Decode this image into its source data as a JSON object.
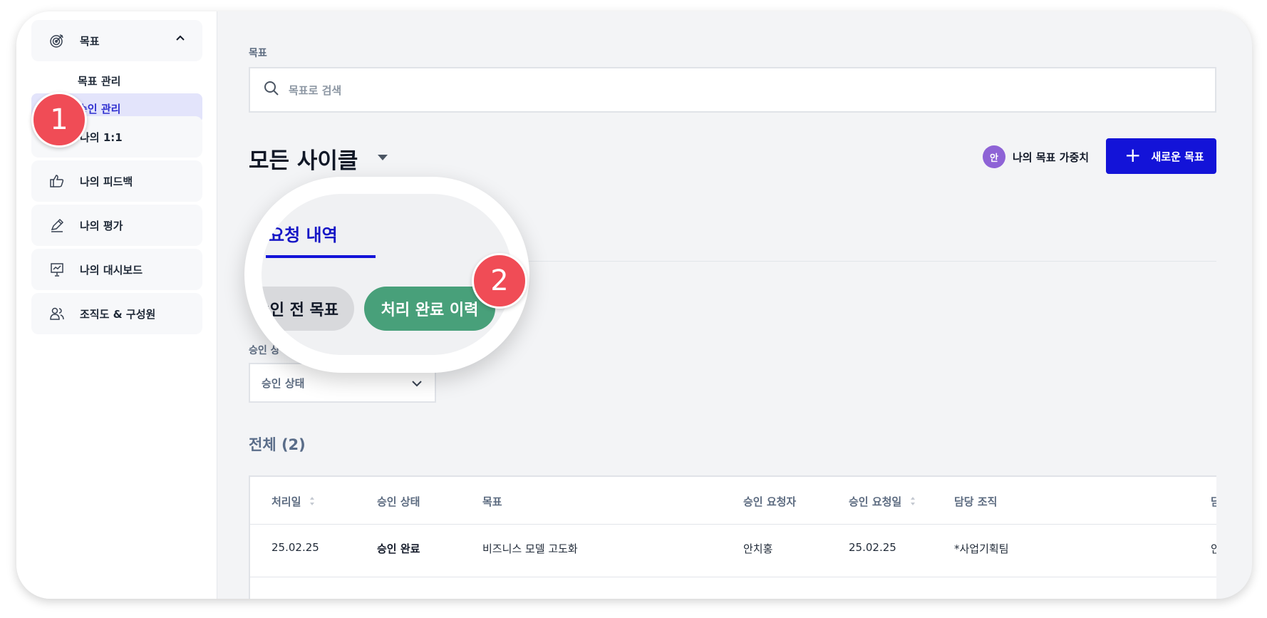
{
  "sidebar": {
    "goal_section": "목표",
    "sub_items": [
      "목표 관리",
      "승인 관리"
    ],
    "items": [
      "나의 1:1",
      "나의 피드백",
      "나의 평가",
      "나의 대시보드",
      "조직도 & 구성원"
    ]
  },
  "search": {
    "label": "목표",
    "placeholder": "목표로 검색"
  },
  "header": {
    "cycle_title": "모든 사이클",
    "weight_avatar": "안",
    "weight_label": "나의 목표 가중치",
    "new_goal_button": "새로운 목표"
  },
  "zoom": {
    "tab_label": "요청 내역",
    "pill_pending": "승인 전 목표",
    "pill_done": "처리 완료 이력"
  },
  "filter": {
    "label": "승인 상",
    "select_value": "승인 상태"
  },
  "total": "전체 (2)",
  "table": {
    "headers": [
      "처리일",
      "승인 상태",
      "목표",
      "승인 요청자",
      "승인 요청일",
      "담당 조직",
      "담"
    ],
    "row": [
      "25.02.25",
      "승인 완료",
      "비즈니스 모델 고도화",
      "안치홍",
      "25.02.25",
      "*사업기획팀",
      "안"
    ]
  },
  "badges": [
    "1",
    "2"
  ],
  "colors": {
    "primary": "#1313d8",
    "green": "#48a07a",
    "badge": "#f04c56",
    "active_bg": "#e3e4fb"
  }
}
